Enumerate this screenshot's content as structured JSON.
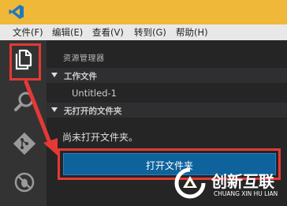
{
  "window": {
    "app_icon": "vscode-icon"
  },
  "menubar": {
    "items": [
      {
        "label": "文件(F)"
      },
      {
        "label": "编辑(E)"
      },
      {
        "label": "查看(V)"
      },
      {
        "label": "转到(G)"
      },
      {
        "label": "帮助(H)"
      }
    ]
  },
  "activitybar": {
    "items": [
      {
        "icon": "files-icon",
        "active": true
      },
      {
        "icon": "search-icon"
      },
      {
        "icon": "git-icon"
      },
      {
        "icon": "debug-icon"
      }
    ]
  },
  "sidebar": {
    "title": "资源管理器",
    "working_files": {
      "header": "工作文件",
      "items": [
        "Untitled-1"
      ]
    },
    "no_folder": {
      "header": "无打开的文件夹",
      "message": "尚未打开文件夹。",
      "button": "打开文件夹"
    }
  },
  "watermark": {
    "brand_cn": "创新互联",
    "brand_en": "CHUANG XIN HU LIAN"
  },
  "colors": {
    "titlebar": "#f0b838",
    "highlight": "#e53935",
    "button": "#0e639c"
  }
}
